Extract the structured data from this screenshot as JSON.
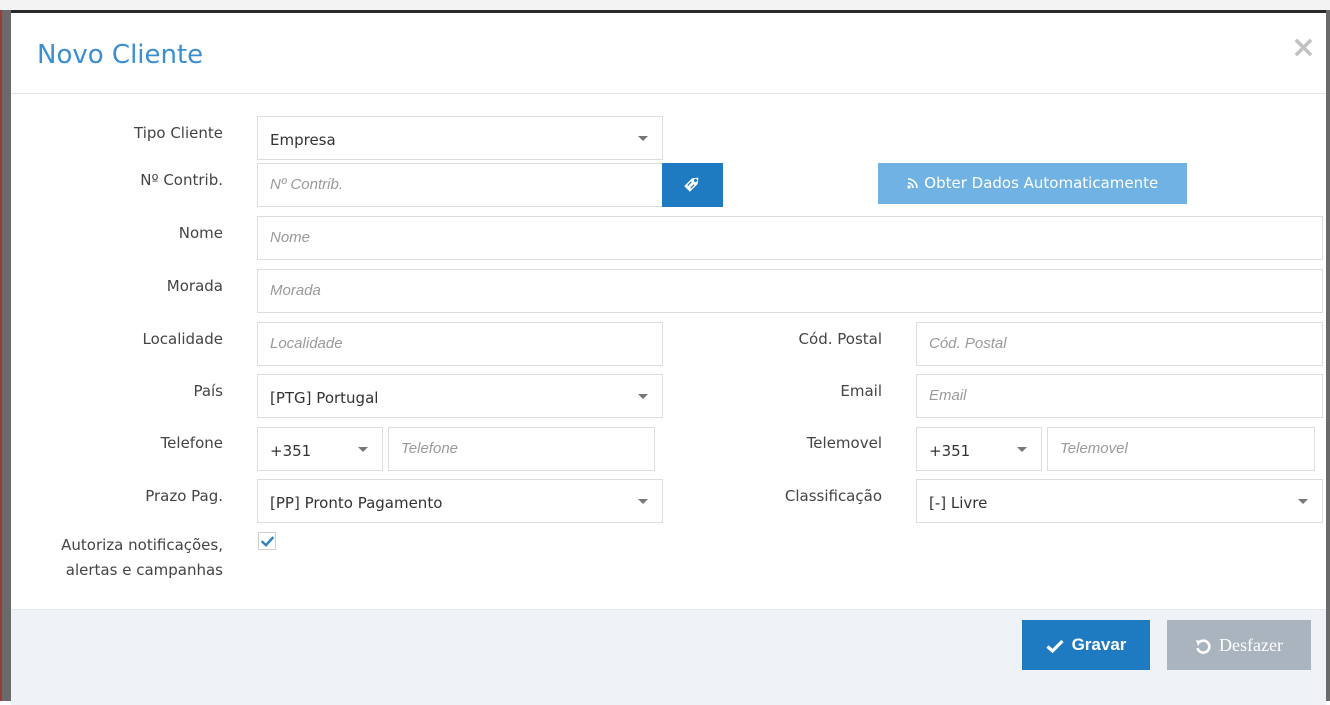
{
  "modal": {
    "title": "Novo Cliente",
    "close_glyph": "×"
  },
  "form": {
    "tipo_cliente": {
      "label": "Tipo Cliente",
      "value": "Empresa"
    },
    "contrib": {
      "label": "Nº Contrib.",
      "placeholder": "Nº Contrib.",
      "lookup_icon": "tag-icon"
    },
    "obter_button": {
      "icon": "rss-icon",
      "label": "Obter Dados Automaticamente"
    },
    "nome": {
      "label": "Nome",
      "placeholder": "Nome"
    },
    "morada": {
      "label": "Morada",
      "placeholder": "Morada"
    },
    "localidade": {
      "label": "Localidade",
      "placeholder": "Localidade"
    },
    "cod_postal": {
      "label": "Cód. Postal",
      "placeholder": "Cód. Postal"
    },
    "pais": {
      "label": "País",
      "value": "[PTG] Portugal"
    },
    "email": {
      "label": "Email",
      "placeholder": "Email"
    },
    "telefone": {
      "label": "Telefone",
      "prefix": "+351",
      "placeholder": "Telefone"
    },
    "telemovel": {
      "label": "Telemovel",
      "prefix": "+351",
      "placeholder": "Telemovel"
    },
    "prazo_pag": {
      "label": "Prazo Pag.",
      "value": "[PP] Pronto Pagamento"
    },
    "classificacao": {
      "label": "Classificação",
      "value": "[-] Livre"
    },
    "autoriza": {
      "label_line1": "Autoriza notificações,",
      "label_line2": "alertas e campanhas",
      "checked": true
    }
  },
  "footer": {
    "gravar_label": "Gravar",
    "desfazer_label": "Desfazer"
  },
  "colors": {
    "primary": "#1f7bc1",
    "secondary": "#6fb2e3",
    "disabled": "#a9b4be",
    "title": "#3a8fd0"
  }
}
